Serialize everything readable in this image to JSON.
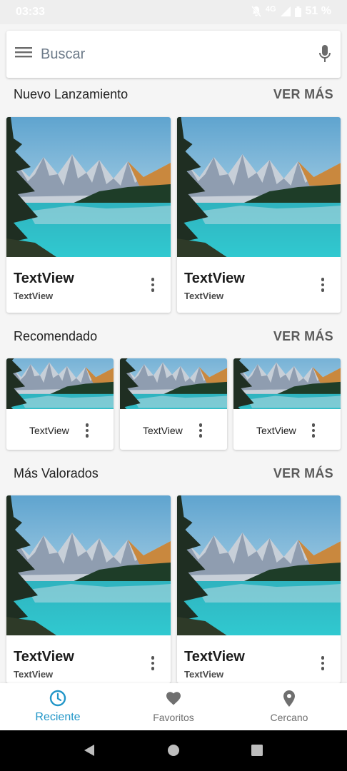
{
  "status_bar": {
    "time": "03:33",
    "network": "4G",
    "battery": "51 %"
  },
  "search": {
    "placeholder": "Buscar"
  },
  "sections": [
    {
      "title": "Nuevo Lanzamiento",
      "see_more": "VER MÁS",
      "cards": [
        {
          "title": "TextView",
          "subtitle": "TextView"
        },
        {
          "title": "TextView",
          "subtitle": "TextView"
        }
      ]
    },
    {
      "title": "Recomendado",
      "see_more": "VER MÁS",
      "cards": [
        {
          "label": "TextView"
        },
        {
          "label": "TextView"
        },
        {
          "label": "TextView"
        }
      ]
    },
    {
      "title": "Más Valorados",
      "see_more": "VER MÁS",
      "cards": [
        {
          "title": "TextView",
          "subtitle": "TextView"
        },
        {
          "title": "TextView",
          "subtitle": "TextView"
        }
      ]
    }
  ],
  "bottom_nav": {
    "items": [
      {
        "label": "Reciente",
        "icon": "clock-icon",
        "active": true
      },
      {
        "label": "Favoritos",
        "icon": "heart-icon",
        "active": false
      },
      {
        "label": "Cercano",
        "icon": "location-pin-icon",
        "active": false
      }
    ]
  },
  "colors": {
    "accent": "#2196c8",
    "background": "#f5f5f5",
    "card": "#ffffff"
  }
}
